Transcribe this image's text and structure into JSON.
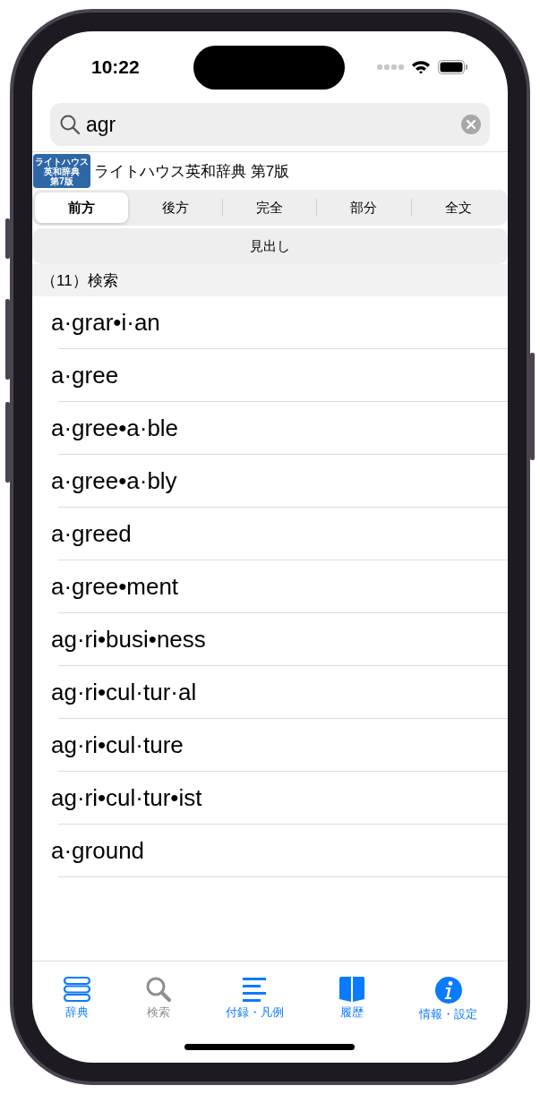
{
  "status_bar": {
    "time": "10:22"
  },
  "search": {
    "value": "agr"
  },
  "dictionary": {
    "logo_lines": [
      "ライトハウス",
      "英和辞典",
      "第7版"
    ],
    "title": "ライトハウス英和辞典 第7版"
  },
  "match_modes": [
    {
      "label": "前方",
      "selected": true
    },
    {
      "label": "後方",
      "selected": false
    },
    {
      "label": "完全",
      "selected": false
    },
    {
      "label": "部分",
      "selected": false
    },
    {
      "label": "全文",
      "selected": false
    }
  ],
  "field_button": "見出し",
  "results_header": "（11）検索",
  "results": [
    "a·grar•i·an",
    "a·gree",
    "a·gree•a·ble",
    "a·gree•a·bly",
    "a·greed",
    "a·gree•ment",
    "ag·ri•busi•ness",
    "ag·ri•cul·tur·al",
    "ag·ri•cul·ture",
    "ag·ri•cul·tur•ist",
    "a·ground"
  ],
  "tab_bar": [
    {
      "kind": "books",
      "label": "辞典",
      "selected": false
    },
    {
      "kind": "search",
      "label": "検索",
      "selected": true
    },
    {
      "kind": "list",
      "label": "付録・凡例",
      "selected": false
    },
    {
      "kind": "book",
      "label": "履歴",
      "selected": false
    },
    {
      "kind": "info",
      "label": "情報・設定",
      "selected": false
    }
  ]
}
